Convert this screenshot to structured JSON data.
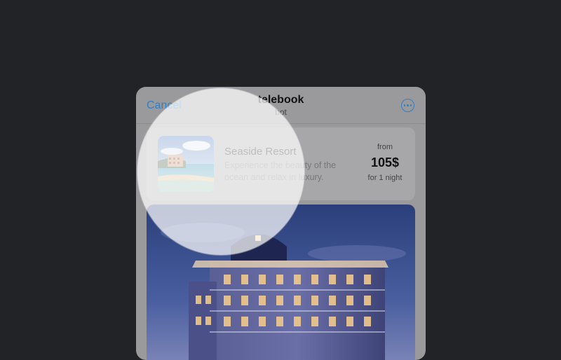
{
  "header": {
    "cancel_label": "Cancel",
    "title": "telebook",
    "subtitle": "bot",
    "more_icon": "more-icon"
  },
  "listing": {
    "name": "Seaside Resort",
    "description": "Experience the beauty of the ocean and relax in luxury.",
    "price_prefix": "from",
    "price": "105$",
    "price_suffix": "for 1 night",
    "thumbnail_icon": "resort-thumbnail-image"
  },
  "hero": {
    "image_icon": "hotel-building-image"
  },
  "colors": {
    "background": "#222326",
    "sheet": "#9a9a9c",
    "accent": "#2f7fc8"
  }
}
